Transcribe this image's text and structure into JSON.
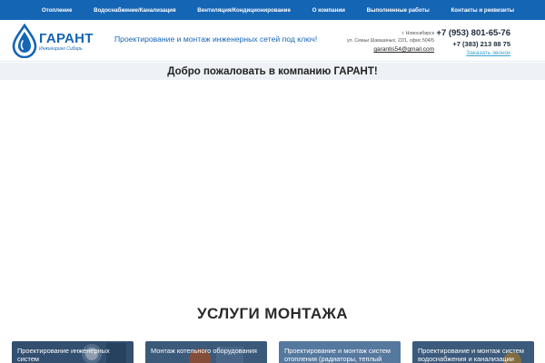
{
  "nav": {
    "items": [
      "Отопление",
      "Водоснабжение/Канализация",
      "Вентиляция/Кондиционирование",
      "О компании",
      "Выполненные работы",
      "Контакты и реквизиты"
    ]
  },
  "header": {
    "logo_name": "ГАРАНТ",
    "logo_sub": "Инжиниринг Сибирь",
    "tagline": "Проектирование и монтаж инженерных сетей под ключ!",
    "address_city": "г. Новосибирск",
    "address_street": "ул. Семьи Шамшиных, 22/1, офис 504/5",
    "email": "garantis54@gmail.com",
    "phone_primary": "+7 (953) 801-65-76",
    "phone_secondary": "+7 (383) 213 88 75",
    "call_link": "Заказать звонок"
  },
  "welcome": {
    "text": "Добро пожаловать в компанию ГАРАНТ!"
  },
  "services": {
    "title": "УСЛУГИ МОНТАЖА",
    "cards": [
      {
        "text": "Проектирование инженерных систем"
      },
      {
        "text": "Монтаж котельного оборудования"
      },
      {
        "text": "Проектирование и монтаж систем отопления (радиаторы, теплый"
      },
      {
        "text": "Проектирование и монтаж систем водоснабжения и канализации"
      }
    ]
  },
  "colors": {
    "brand_blue": "#1565b5",
    "link_cyan": "#3aa3d8"
  }
}
